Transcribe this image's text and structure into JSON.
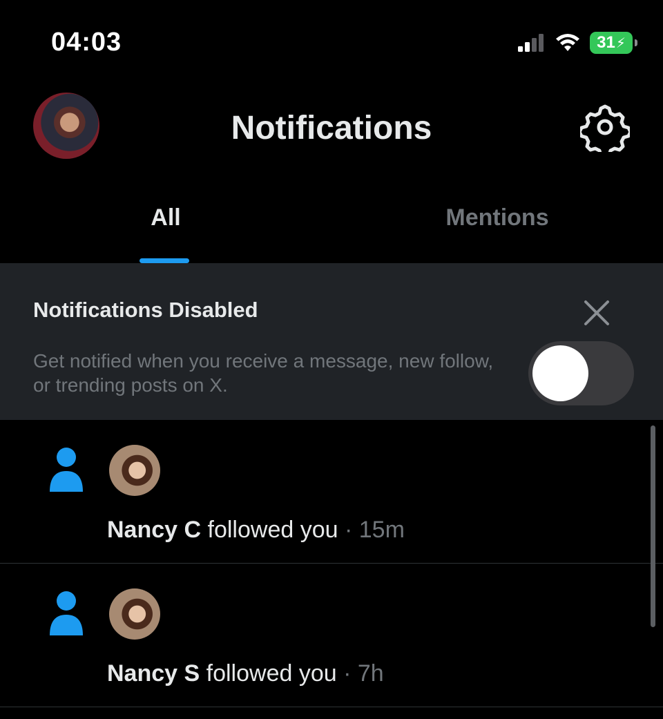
{
  "status_bar": {
    "time": "04:03",
    "battery_level": "31",
    "icons": [
      "signal-icon",
      "wifi-icon",
      "battery-charging-icon"
    ]
  },
  "header": {
    "title": "Notifications",
    "avatar": "profile-avatar",
    "settings_icon": "gear-icon"
  },
  "tabs": [
    {
      "label": "All",
      "selected": true
    },
    {
      "label": "Mentions",
      "selected": false
    }
  ],
  "banner": {
    "title": "Notifications Disabled",
    "text": "Get notified when you receive a message, new follow, or trending posts on X.",
    "toggle_on": false,
    "close_icon": "close-icon"
  },
  "notifications": [
    {
      "name": "Nancy C",
      "action": "followed you",
      "separator": "·",
      "time": "15m"
    },
    {
      "name": "Nancy S",
      "action": "followed you",
      "separator": "·",
      "time": "7h"
    }
  ],
  "colors": {
    "accent": "#1d9bf0",
    "background": "#000000",
    "banner_bg": "#202327",
    "muted_text": "#71767b",
    "battery": "#34c759"
  }
}
